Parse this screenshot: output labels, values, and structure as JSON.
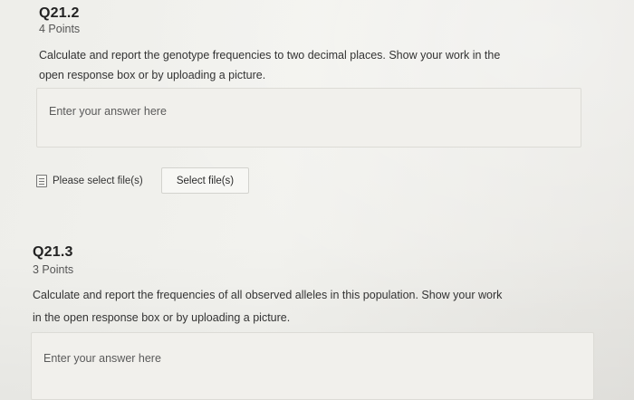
{
  "questions": [
    {
      "id": "Q21.2",
      "points": "4 Points",
      "text_line1": "Calculate and report the genotype frequencies to two decimal places. Show your work in the",
      "text_line2": "open response box or by uploading a picture.",
      "answer_placeholder": "Enter your answer here",
      "file_label": "Please select file(s)",
      "select_button": "Select file(s)"
    },
    {
      "id": "Q21.3",
      "points": "3 Points",
      "text_line1": "Calculate and report the frequencies of all observed alleles in this population. Show your work",
      "text_line2": "in the open response box or by uploading a picture.",
      "answer_placeholder": "Enter your answer here"
    }
  ],
  "icons": {
    "file": "file-icon"
  }
}
